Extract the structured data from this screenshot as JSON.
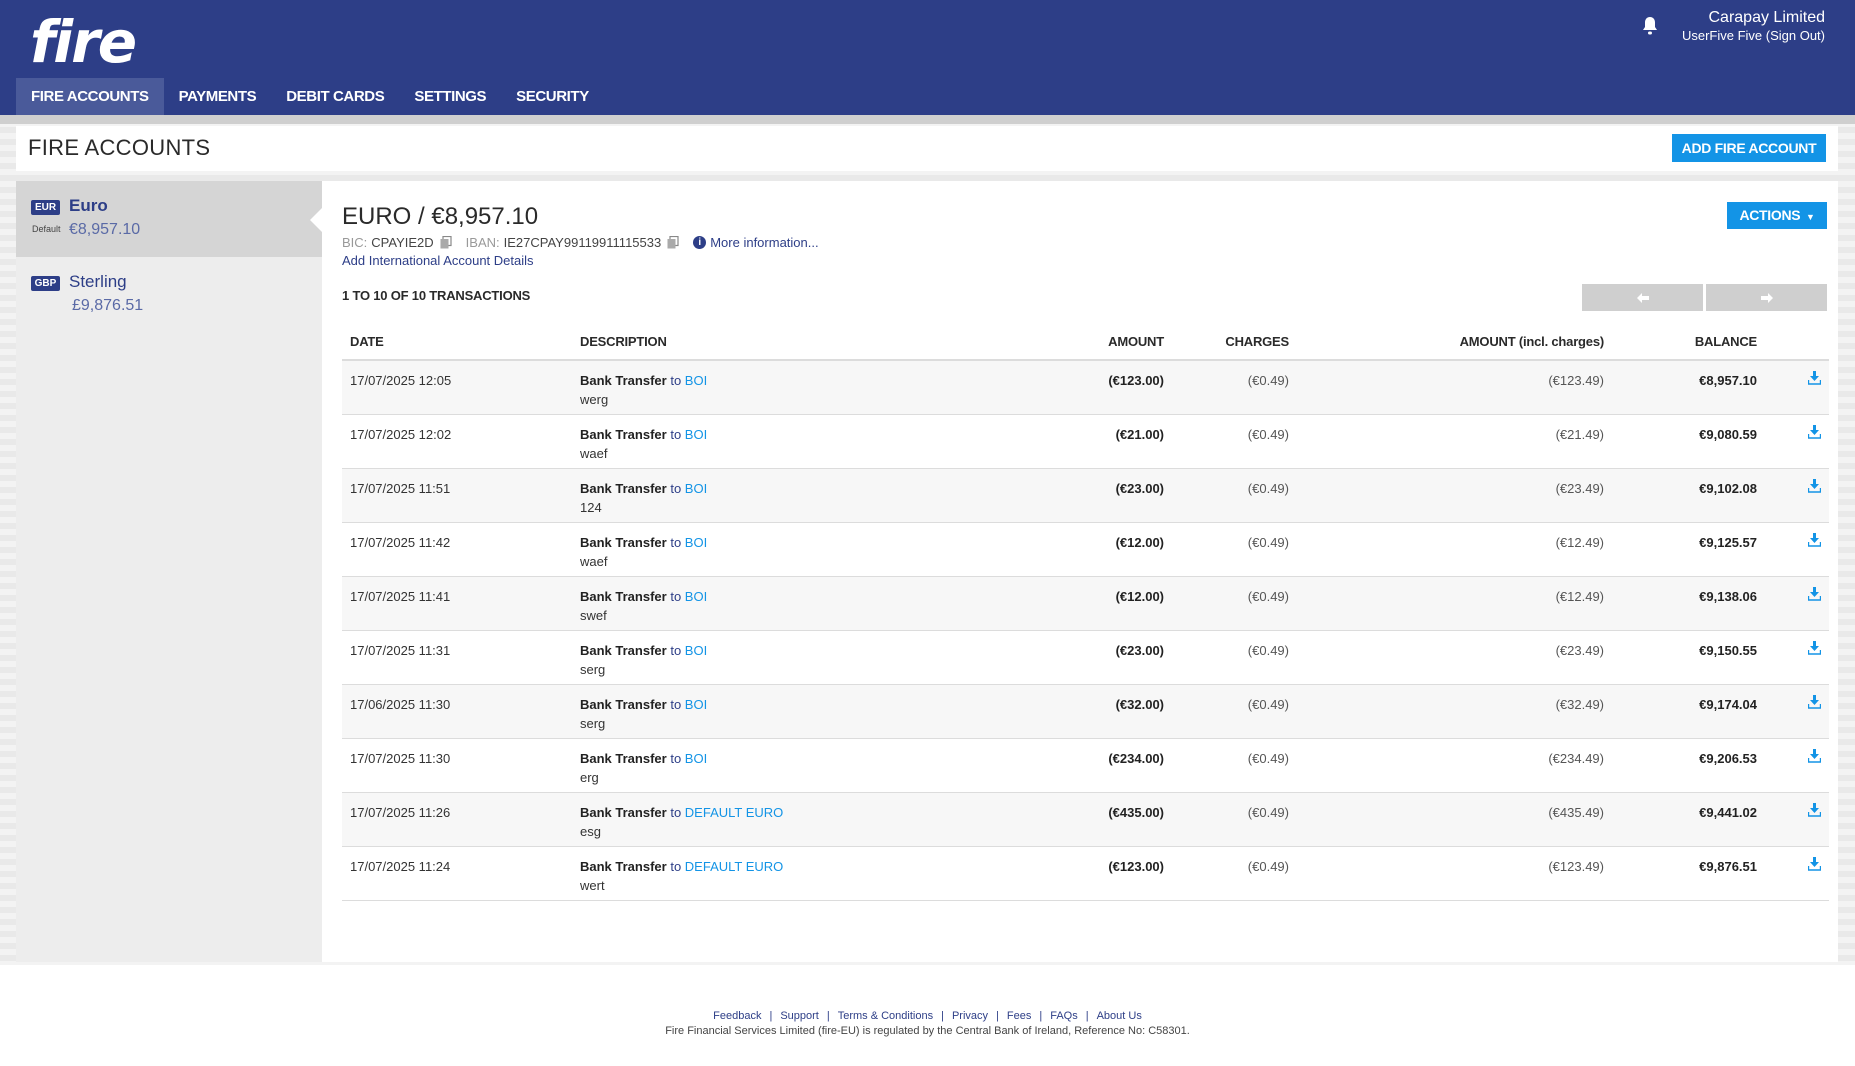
{
  "header": {
    "logo_text": "fire",
    "company": "Carapay Limited",
    "user": "UserFive Five (Sign Out)",
    "nav": [
      {
        "label": "FIRE ACCOUNTS"
      },
      {
        "label": "PAYMENTS"
      },
      {
        "label": "DEBIT CARDS"
      },
      {
        "label": "SETTINGS"
      },
      {
        "label": "SECURITY"
      }
    ]
  },
  "page": {
    "title": "FIRE ACCOUNTS",
    "add_button": "ADD FIRE ACCOUNT"
  },
  "accounts": [
    {
      "currency": "EUR",
      "name": "Euro",
      "default_label": "Default",
      "balance": "€8,957.10"
    },
    {
      "currency": "GBP",
      "name": "Sterling",
      "balance": "£9,876.51"
    }
  ],
  "account_detail": {
    "heading": "EURO / €8,957.10",
    "bic_label": "BIC:",
    "bic": "CPAYIE2D",
    "iban_label": "IBAN:",
    "iban": "IE27CPAY99119911115533",
    "more_info": "More information...",
    "add_intl": "Add International Account Details",
    "actions_label": "ACTIONS",
    "txn_count": "1 TO 10 OF 10 TRANSACTIONS"
  },
  "table": {
    "headers": {
      "date": "DATE",
      "description": "DESCRIPTION",
      "amount": "AMOUNT",
      "charges": "CHARGES",
      "amount_incl": "AMOUNT (incl. charges)",
      "balance": "BALANCE"
    },
    "rows": [
      {
        "date": "17/07/2025 12:05",
        "type": "Bank Transfer",
        "to": "to",
        "target": "BOI",
        "ref": "werg",
        "amount": "(€123.00)",
        "charges": "(€0.49)",
        "amount_incl": "(€123.49)",
        "balance": "€8,957.10"
      },
      {
        "date": "17/07/2025 12:02",
        "type": "Bank Transfer",
        "to": "to",
        "target": "BOI",
        "ref": "waef",
        "amount": "(€21.00)",
        "charges": "(€0.49)",
        "amount_incl": "(€21.49)",
        "balance": "€9,080.59"
      },
      {
        "date": "17/07/2025 11:51",
        "type": "Bank Transfer",
        "to": "to",
        "target": "BOI",
        "ref": "124",
        "amount": "(€23.00)",
        "charges": "(€0.49)",
        "amount_incl": "(€23.49)",
        "balance": "€9,102.08"
      },
      {
        "date": "17/07/2025 11:42",
        "type": "Bank Transfer",
        "to": "to",
        "target": "BOI",
        "ref": "waef",
        "amount": "(€12.00)",
        "charges": "(€0.49)",
        "amount_incl": "(€12.49)",
        "balance": "€9,125.57"
      },
      {
        "date": "17/07/2025 11:41",
        "type": "Bank Transfer",
        "to": "to",
        "target": "BOI",
        "ref": "swef",
        "amount": "(€12.00)",
        "charges": "(€0.49)",
        "amount_incl": "(€12.49)",
        "balance": "€9,138.06"
      },
      {
        "date": "17/07/2025 11:31",
        "type": "Bank Transfer",
        "to": "to",
        "target": "BOI",
        "ref": "serg",
        "amount": "(€23.00)",
        "charges": "(€0.49)",
        "amount_incl": "(€23.49)",
        "balance": "€9,150.55"
      },
      {
        "date": "17/06/2025 11:30",
        "type": "Bank Transfer",
        "to": "to",
        "target": "BOI",
        "ref": "serg",
        "amount": "(€32.00)",
        "charges": "(€0.49)",
        "amount_incl": "(€32.49)",
        "balance": "€9,174.04"
      },
      {
        "date": "17/07/2025 11:30",
        "type": "Bank Transfer",
        "to": "to",
        "target": "BOI",
        "ref": "erg",
        "amount": "(€234.00)",
        "charges": "(€0.49)",
        "amount_incl": "(€234.49)",
        "balance": "€9,206.53"
      },
      {
        "date": "17/07/2025 11:26",
        "type": "Bank Transfer",
        "to": "to",
        "target": "DEFAULT EURO",
        "ref": "esg",
        "amount": "(€435.00)",
        "charges": "(€0.49)",
        "amount_incl": "(€435.49)",
        "balance": "€9,441.02"
      },
      {
        "date": "17/07/2025 11:24",
        "type": "Bank Transfer",
        "to": "to",
        "target": "DEFAULT EURO",
        "ref": "wert",
        "amount": "(€123.00)",
        "charges": "(€0.49)",
        "amount_incl": "(€123.49)",
        "balance": "€9,876.51"
      }
    ]
  },
  "footer": {
    "links": [
      "Feedback",
      "Support",
      "Terms & Conditions",
      "Privacy",
      "Fees",
      "FAQs",
      "About Us"
    ],
    "legal": "Fire Financial Services Limited (fire-EU) is regulated by the Central Bank of Ireland, Reference No: C58301."
  },
  "colors": {
    "brand": "#2d3e87",
    "accent": "#1394e6"
  }
}
